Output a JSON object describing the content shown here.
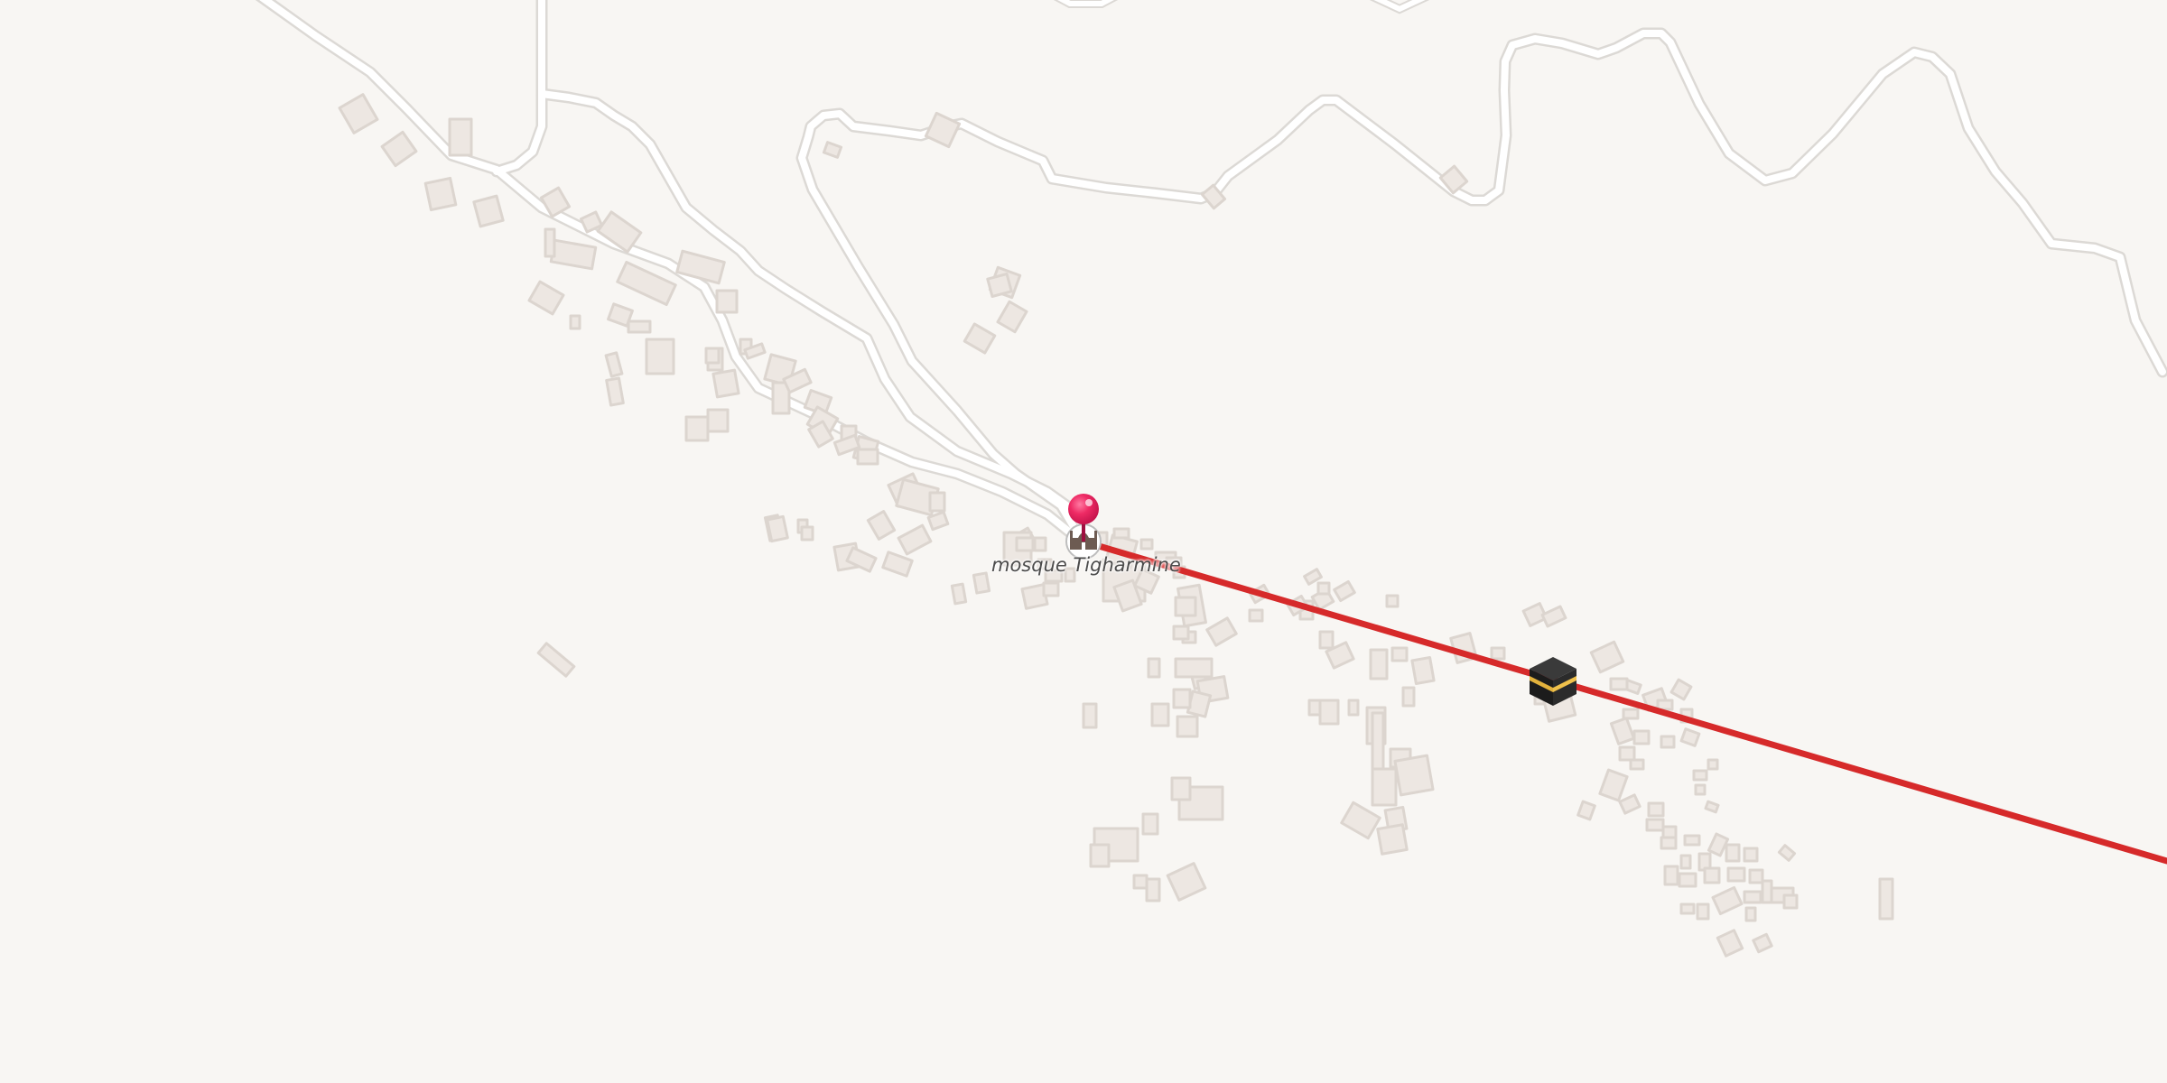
{
  "map": {
    "poi": {
      "label": "mosque Tigharmine",
      "icon": "mosque-icon"
    },
    "pin": {
      "icon": "map-pin-icon",
      "color": "#e8205a"
    },
    "qibla": {
      "line_color": "#d62a2a",
      "target_icon": "kaaba-icon"
    },
    "colors": {
      "background": "#f8f6f3",
      "road_fill": "#ffffff",
      "road_casing": "#dcd9d5",
      "building": "#ede7e2",
      "building_edge": "#dcd5cf"
    }
  }
}
